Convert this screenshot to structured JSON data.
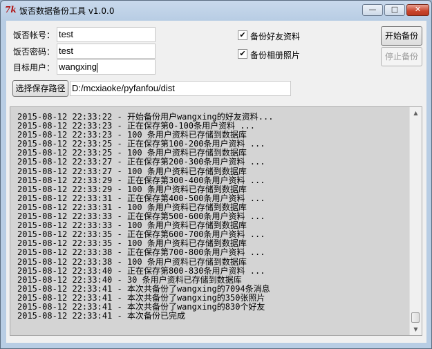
{
  "window": {
    "title": "饭否数据备份工具 v1.0.0",
    "icon_text": "7k",
    "min_glyph": "—",
    "max_glyph": "□",
    "close_glyph": "✕"
  },
  "form": {
    "account_label": "饭否帐号：",
    "account_value": "test",
    "password_label": "饭否密码：",
    "password_value": "test",
    "target_label": "目标用户：",
    "target_value": "wangxing",
    "path_button": "选择保存路径",
    "path_value": "D:/mcxiaoke/pyfanfou/dist"
  },
  "options": {
    "backup_friends": {
      "label": "备份好友资料",
      "checked": true,
      "mark": "✔"
    },
    "backup_photos": {
      "label": "备份相册照片",
      "checked": true,
      "mark": "✔"
    }
  },
  "buttons": {
    "start": "开始备份",
    "stop": "停止备份"
  },
  "log": {
    "lines": [
      "2015-08-12 22:33:22 - 开始备份用户wangxing的好友资料...",
      "2015-08-12 22:33:23 - 正在保存第0-100条用户资料 ...",
      "2015-08-12 22:33:23 - 100 条用户资料已存储到数据库",
      "2015-08-12 22:33:25 - 正在保存第100-200条用户资料 ...",
      "2015-08-12 22:33:25 - 100 条用户资料已存储到数据库",
      "2015-08-12 22:33:27 - 正在保存第200-300条用户资料 ...",
      "2015-08-12 22:33:27 - 100 条用户资料已存储到数据库",
      "2015-08-12 22:33:29 - 正在保存第300-400条用户资料 ...",
      "2015-08-12 22:33:29 - 100 条用户资料已存储到数据库",
      "2015-08-12 22:33:31 - 正在保存第400-500条用户资料 ...",
      "2015-08-12 22:33:31 - 100 条用户资料已存储到数据库",
      "2015-08-12 22:33:33 - 正在保存第500-600条用户资料 ...",
      "2015-08-12 22:33:33 - 100 条用户资料已存储到数据库",
      "2015-08-12 22:33:35 - 正在保存第600-700条用户资料 ...",
      "2015-08-12 22:33:35 - 100 条用户资料已存储到数据库",
      "2015-08-12 22:33:38 - 正在保存第700-800条用户资料 ...",
      "2015-08-12 22:33:38 - 100 条用户资料已存储到数据库",
      "2015-08-12 22:33:40 - 正在保存第800-830条用户资料 ...",
      "2015-08-12 22:33:40 - 30 条用户资料已存储到数据库",
      "2015-08-12 22:33:41 - 本次共备份了wangxing的7094条消息",
      "2015-08-12 22:33:41 - 本次共备份了wangxing的350张照片",
      "2015-08-12 22:33:41 - 本次共备份了wangxing的830个好友",
      "2015-08-12 22:33:41 - 本次备份已完成"
    ]
  },
  "scrollbar": {
    "up_glyph": "▲",
    "down_glyph": "▼"
  }
}
